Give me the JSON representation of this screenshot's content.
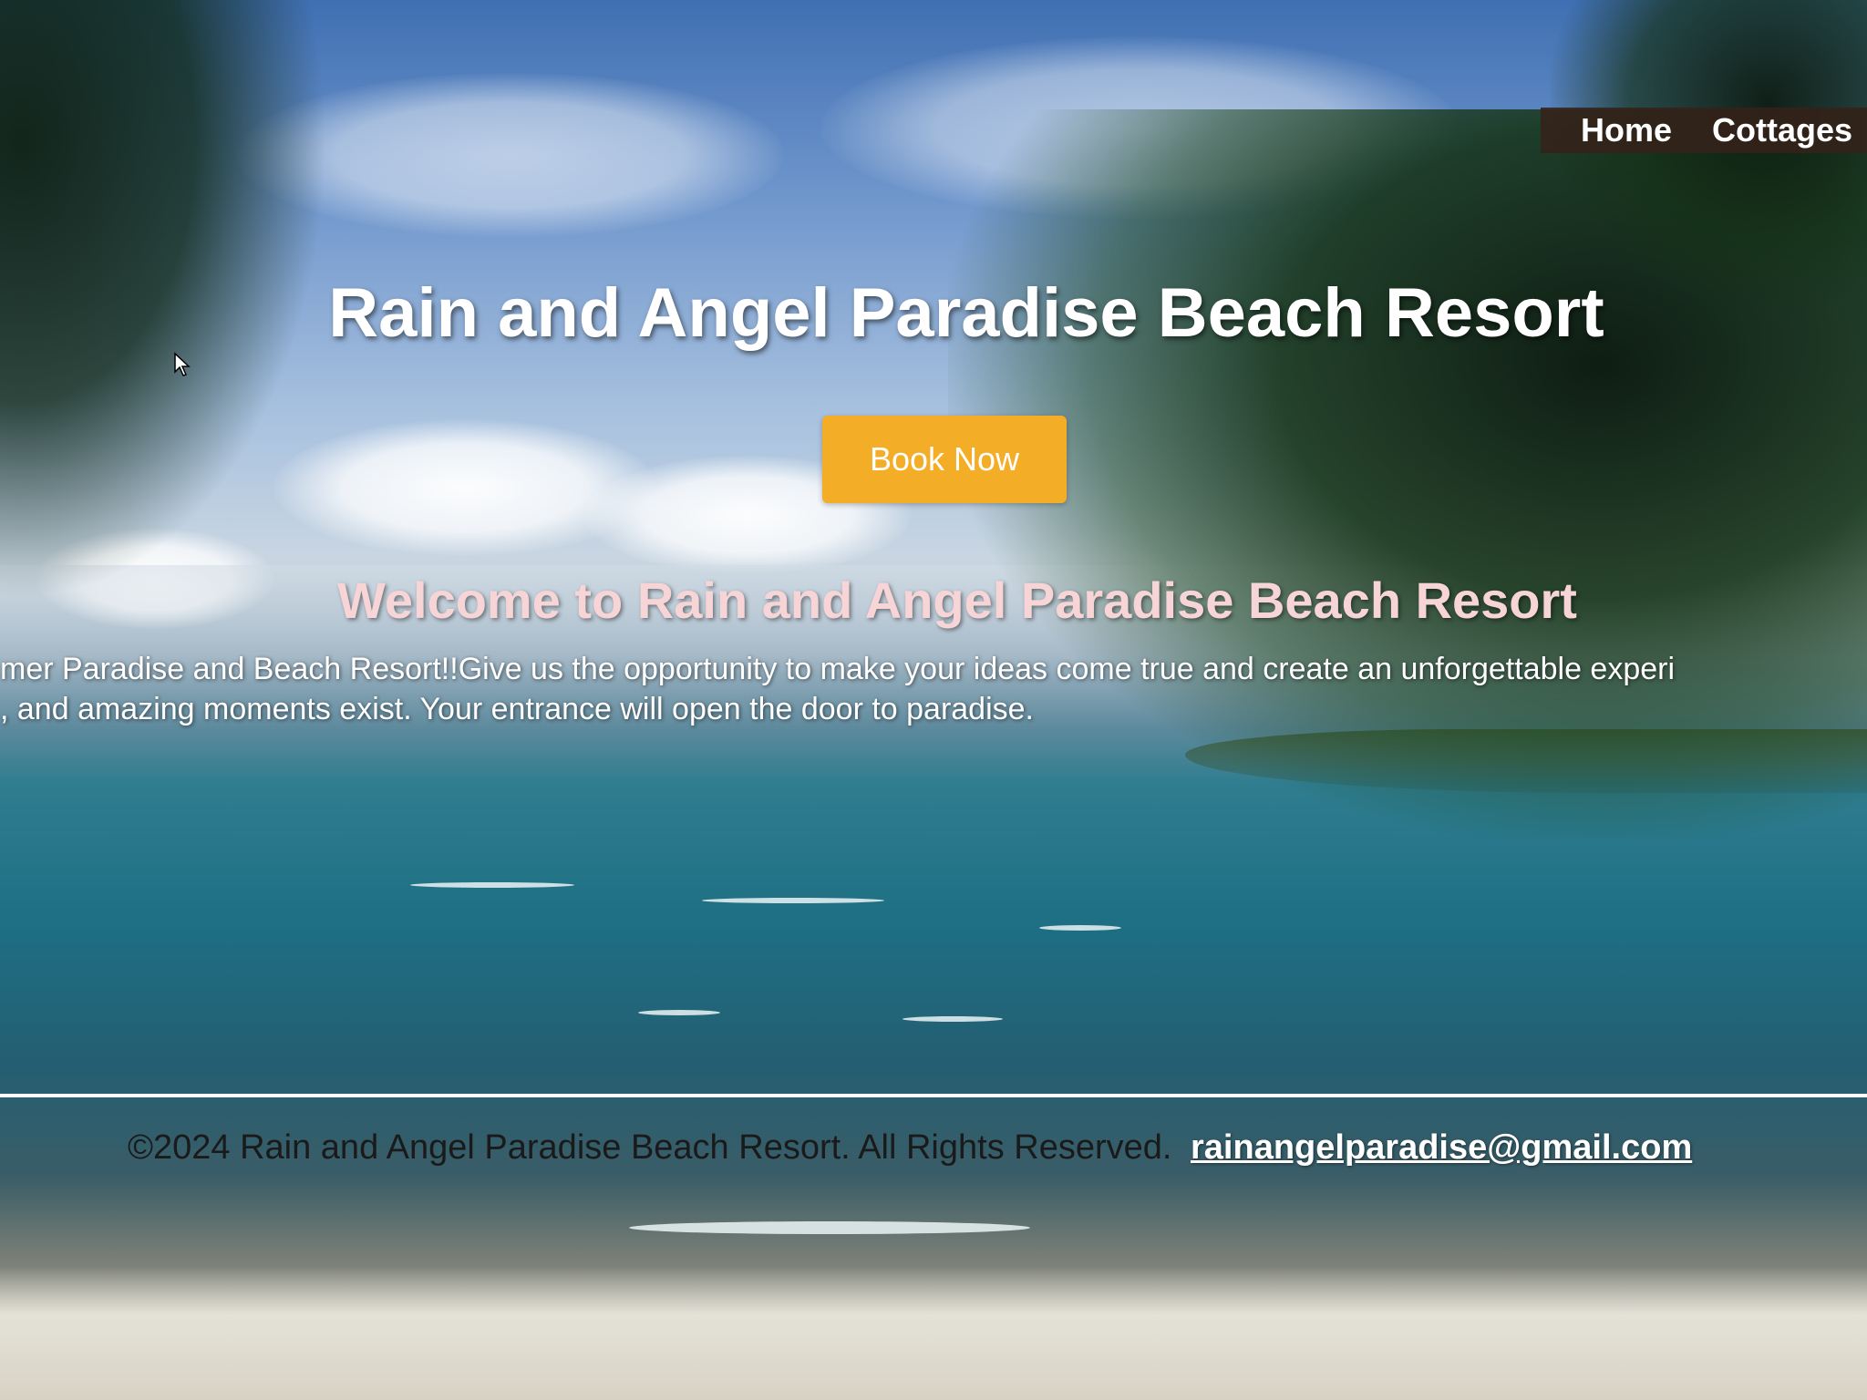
{
  "nav": {
    "items": [
      {
        "label": "Home"
      },
      {
        "label": "Cottages"
      }
    ]
  },
  "hero": {
    "title": "Rain and Angel Paradise Beach Resort",
    "cta_label": "Book Now"
  },
  "welcome": {
    "heading": "Welcome to Rain and Angel Paradise Beach Resort",
    "line1": "mer Paradise and Beach Resort!!Give us the opportunity to make your ideas come true and create an unforgettable experi",
    "line2": ", and amazing moments exist. Your entrance will open the door to paradise."
  },
  "footer": {
    "copyright": "©2024 Rain and Angel Paradise Beach Resort. All Rights Reserved.",
    "email": "rainangelparadise@gmail.com"
  },
  "colors": {
    "cta": "#f4ad27",
    "welcome_heading": "#f7d4d6",
    "nav_background": "#34221a"
  }
}
